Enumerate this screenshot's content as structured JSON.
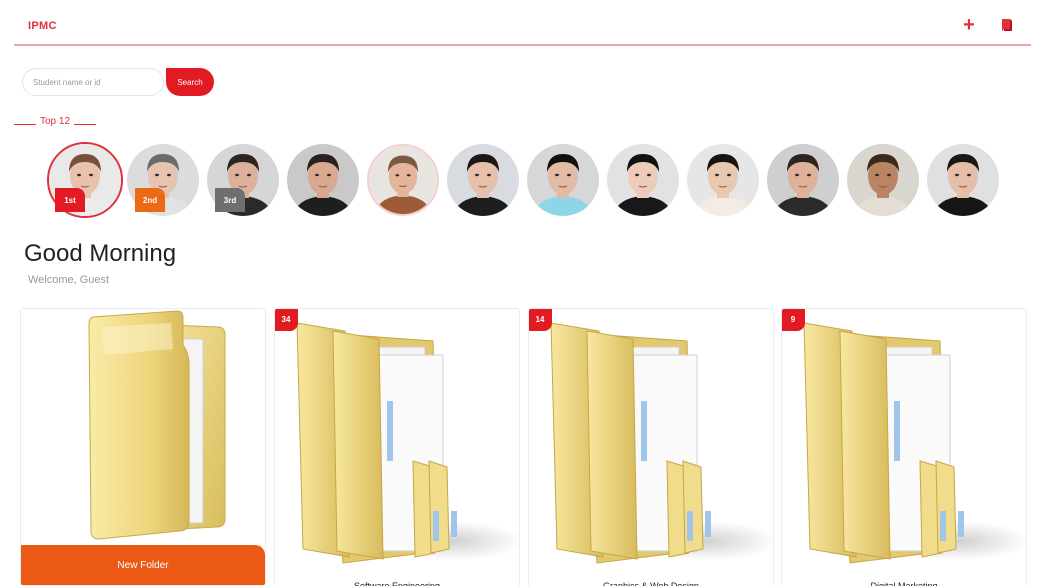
{
  "header": {
    "brand": "IPMC",
    "add_icon": "plus-icon",
    "book_icon": "book-icon",
    "accent": "#e0303b"
  },
  "search": {
    "placeholder": "Student name or id",
    "button_label": "Search"
  },
  "top_section": {
    "title": "Top 12"
  },
  "top_students": [
    {
      "rank_label": "1st",
      "rank_color": "#e21a22",
      "skin": "#e8c2ad",
      "hair": "#7a4f3a",
      "shirt": "#ececec",
      "bg": "#e9e9e9"
    },
    {
      "rank_label": "2nd",
      "rank_color": "#ea6a16",
      "skin": "#e6c4b0",
      "hair": "#6b6b6b",
      "shirt": "#e2e2e2",
      "bg": "#dcdcdc"
    },
    {
      "rank_label": "3rd",
      "rank_color": "#6f6f6f",
      "skin": "#dcb09a",
      "hair": "#2d2520",
      "shirt": "#2a2a2a",
      "bg": "#d6d6d6"
    },
    {
      "rank_label": "",
      "skin": "#d9a98f",
      "hair": "#2b2220",
      "shirt": "#1e1e1e",
      "bg": "#c9c9c9"
    },
    {
      "rank_label": "",
      "skin": "#e3b59a",
      "hair": "#7b5a45",
      "shirt": "#9c5b35",
      "bg": "#e8e4e0"
    },
    {
      "rank_label": "",
      "skin": "#e6c0aa",
      "hair": "#1c1715",
      "shirt": "#1d1d1d",
      "bg": "#d8dbe0"
    },
    {
      "rank_label": "",
      "skin": "#e1bba6",
      "hair": "#141010",
      "shirt": "#8fd5ea",
      "bg": "#d7d7d7"
    },
    {
      "rank_label": "",
      "skin": "#ecccb8",
      "hair": "#111111",
      "shirt": "#181818",
      "bg": "#e2e2e2"
    },
    {
      "rank_label": "",
      "skin": "#e9c8b0",
      "hair": "#1a1410",
      "shirt": "#f2ece5",
      "bg": "#e6e6e6"
    },
    {
      "rank_label": "",
      "skin": "#ddb19a",
      "hair": "#2e2520",
      "shirt": "#2b2b2b",
      "bg": "#cfcfcf"
    },
    {
      "rank_label": "",
      "skin": "#b98562",
      "hair": "#3d2a1e",
      "shirt": "#e3ddd3",
      "bg": "#d9d5cf"
    },
    {
      "rank_label": "",
      "skin": "#e4bea8",
      "hair": "#1b1715",
      "shirt": "#161616",
      "bg": "#e0e0e0"
    }
  ],
  "greeting": {
    "title": "Good Morning",
    "subtitle": "Welcome, Guest"
  },
  "new_folder": {
    "label": "New Folder",
    "color": "#ea5a14"
  },
  "folders": [
    {
      "count": "34",
      "name": "Software Engineering"
    },
    {
      "count": "14",
      "name": "Graphics & Web Design"
    },
    {
      "count": "9",
      "name": "Digital Marketing"
    }
  ]
}
